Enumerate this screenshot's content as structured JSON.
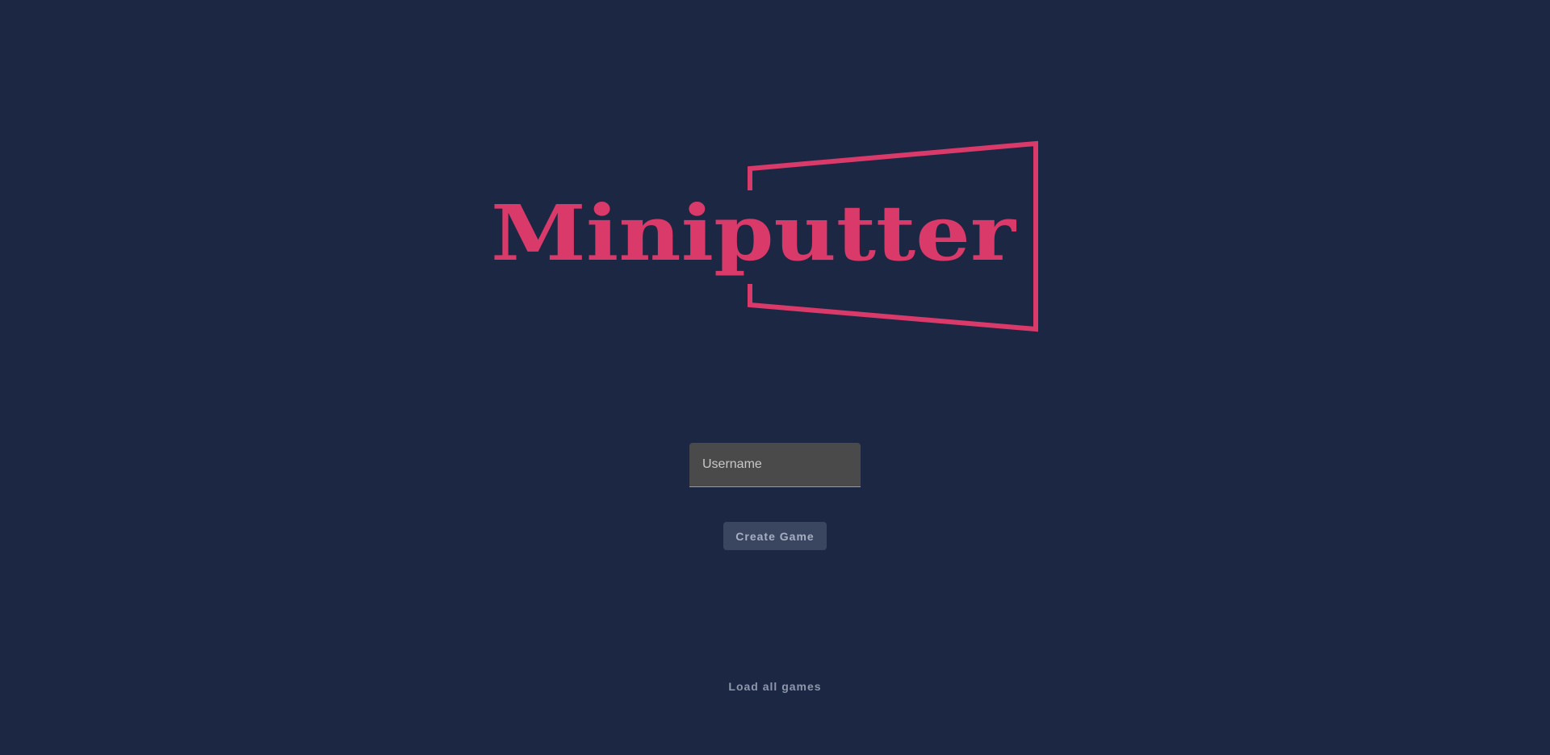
{
  "logo": {
    "text": "Miniputter",
    "color": "#d93a6a"
  },
  "form": {
    "username_placeholder": "Username",
    "username_value": "",
    "create_label": "Create Game"
  },
  "footer": {
    "load_label": "Load all games"
  },
  "colors": {
    "background": "#1c2744",
    "accent": "#d93a6a",
    "input_bg": "#4a4a4a",
    "button_bg": "#3a4560"
  }
}
